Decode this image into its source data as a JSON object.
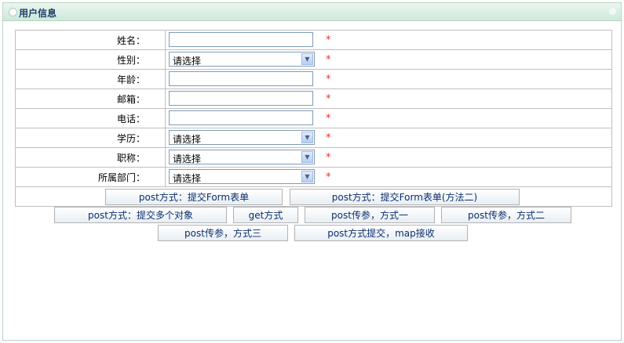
{
  "header": {
    "title": "用户信息"
  },
  "form": {
    "rows": [
      {
        "label": "姓名：",
        "type": "text",
        "value": "",
        "required": "*"
      },
      {
        "label": "性别：",
        "type": "select",
        "value": "请选择",
        "required": "*"
      },
      {
        "label": "年龄：",
        "type": "text",
        "value": "",
        "required": "*"
      },
      {
        "label": "邮箱：",
        "type": "text",
        "value": "",
        "required": "*"
      },
      {
        "label": "电话：",
        "type": "text",
        "value": "",
        "required": "*"
      },
      {
        "label": "学历：",
        "type": "select",
        "value": "请选择",
        "required": "*"
      },
      {
        "label": "职称：",
        "type": "select",
        "value": "请选择",
        "required": "*"
      },
      {
        "label": "所属部门：",
        "type": "select",
        "value": "请选择",
        "required": "*"
      }
    ]
  },
  "buttons": {
    "post_form": "post方式：提交Form表单",
    "post_form_2": "post方式：提交Form表单(方法二)",
    "post_multi": "post方式：提交多个对象",
    "get": "get方式",
    "post_param_1": "post传参，方式一",
    "post_param_2": "post传参，方式二",
    "post_param_3": "post传参，方式三",
    "post_map": "post方式提交，map接收"
  },
  "colors": {
    "header_bg": "#cfe8da",
    "title": "#1f3e6a",
    "required": "#e5322b",
    "button_text": "#0a2e6e"
  }
}
